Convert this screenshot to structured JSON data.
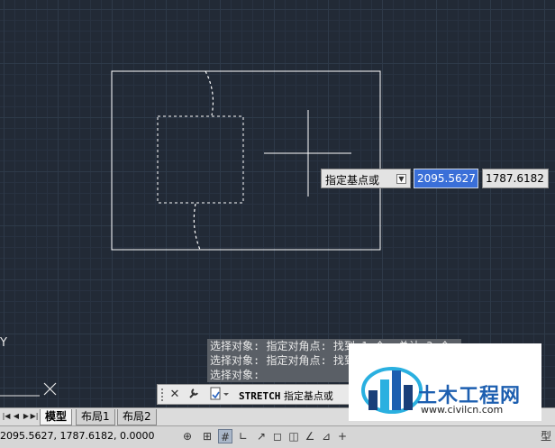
{
  "canvas": {
    "colors": {
      "background": "#222a36",
      "grid_major": "#2e3a49",
      "grid_minor": "#283241",
      "geometry": "#ffffff"
    }
  },
  "dynamic_input": {
    "prompt_label": "指定基点或",
    "dropdown_icon": "down-arrow-icon",
    "x_value": "2095.5627",
    "y_value": "1787.6182"
  },
  "command_history": [
    "选择对象: 指定对角点: 找到 1 个, 总计 3 个",
    "选择对象: 指定对角点: 找到 1 个, 总计 3 个",
    "选择对象:"
  ],
  "command_line": {
    "close_label": "✕",
    "settings_icon": "wrench-icon",
    "recent_icon": "command-recent-icon",
    "command_prefix": "STRETCH",
    "prompt": "指定基点或"
  },
  "tabs": [
    {
      "label": "模型",
      "active": true
    },
    {
      "label": "布局1",
      "active": false
    },
    {
      "label": "布局2",
      "active": false
    }
  ],
  "status_bar": {
    "coordinates": "2095.5627, 1787.6182, 0.0000",
    "model_label": "型"
  },
  "ucs": {
    "y_label": "Y"
  },
  "watermark": {
    "title": "土木工程网",
    "url": "www.civilcn.com",
    "colors": {
      "blue": "#1d5fb0",
      "cyan": "#2ab0e0",
      "dark": "#1a3f7a"
    }
  }
}
